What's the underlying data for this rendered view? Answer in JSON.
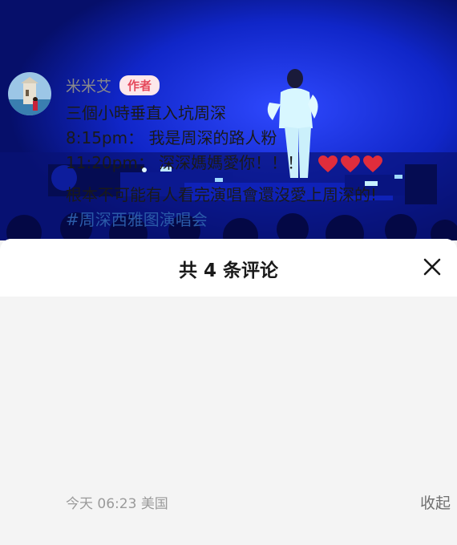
{
  "sheet": {
    "title": "共 4 条评论"
  },
  "comment": {
    "author": "米米艾",
    "badge": "作者",
    "lines": [
      "三個小時垂直入坑周深",
      "8:15pm： 我是周深的路人粉",
      "11:20pm： 深深媽媽愛你！！！"
    ],
    "line4": "根本不可能有人看完演唱會還沒愛上周深的!",
    "hashtag": "#周深西雅图演唱会",
    "time": "今天 06:23",
    "location": "美国",
    "collapse_label": "收起"
  },
  "icons": {
    "close": "close-icon",
    "heart": "red-heart-icon"
  },
  "colors": {
    "badge_text": "#e5485b",
    "badge_bg": "#fde7ea",
    "hashtag": "#2a5aa8",
    "heart": "#e02d3c",
    "stage_blue": "#0a1f9e"
  }
}
